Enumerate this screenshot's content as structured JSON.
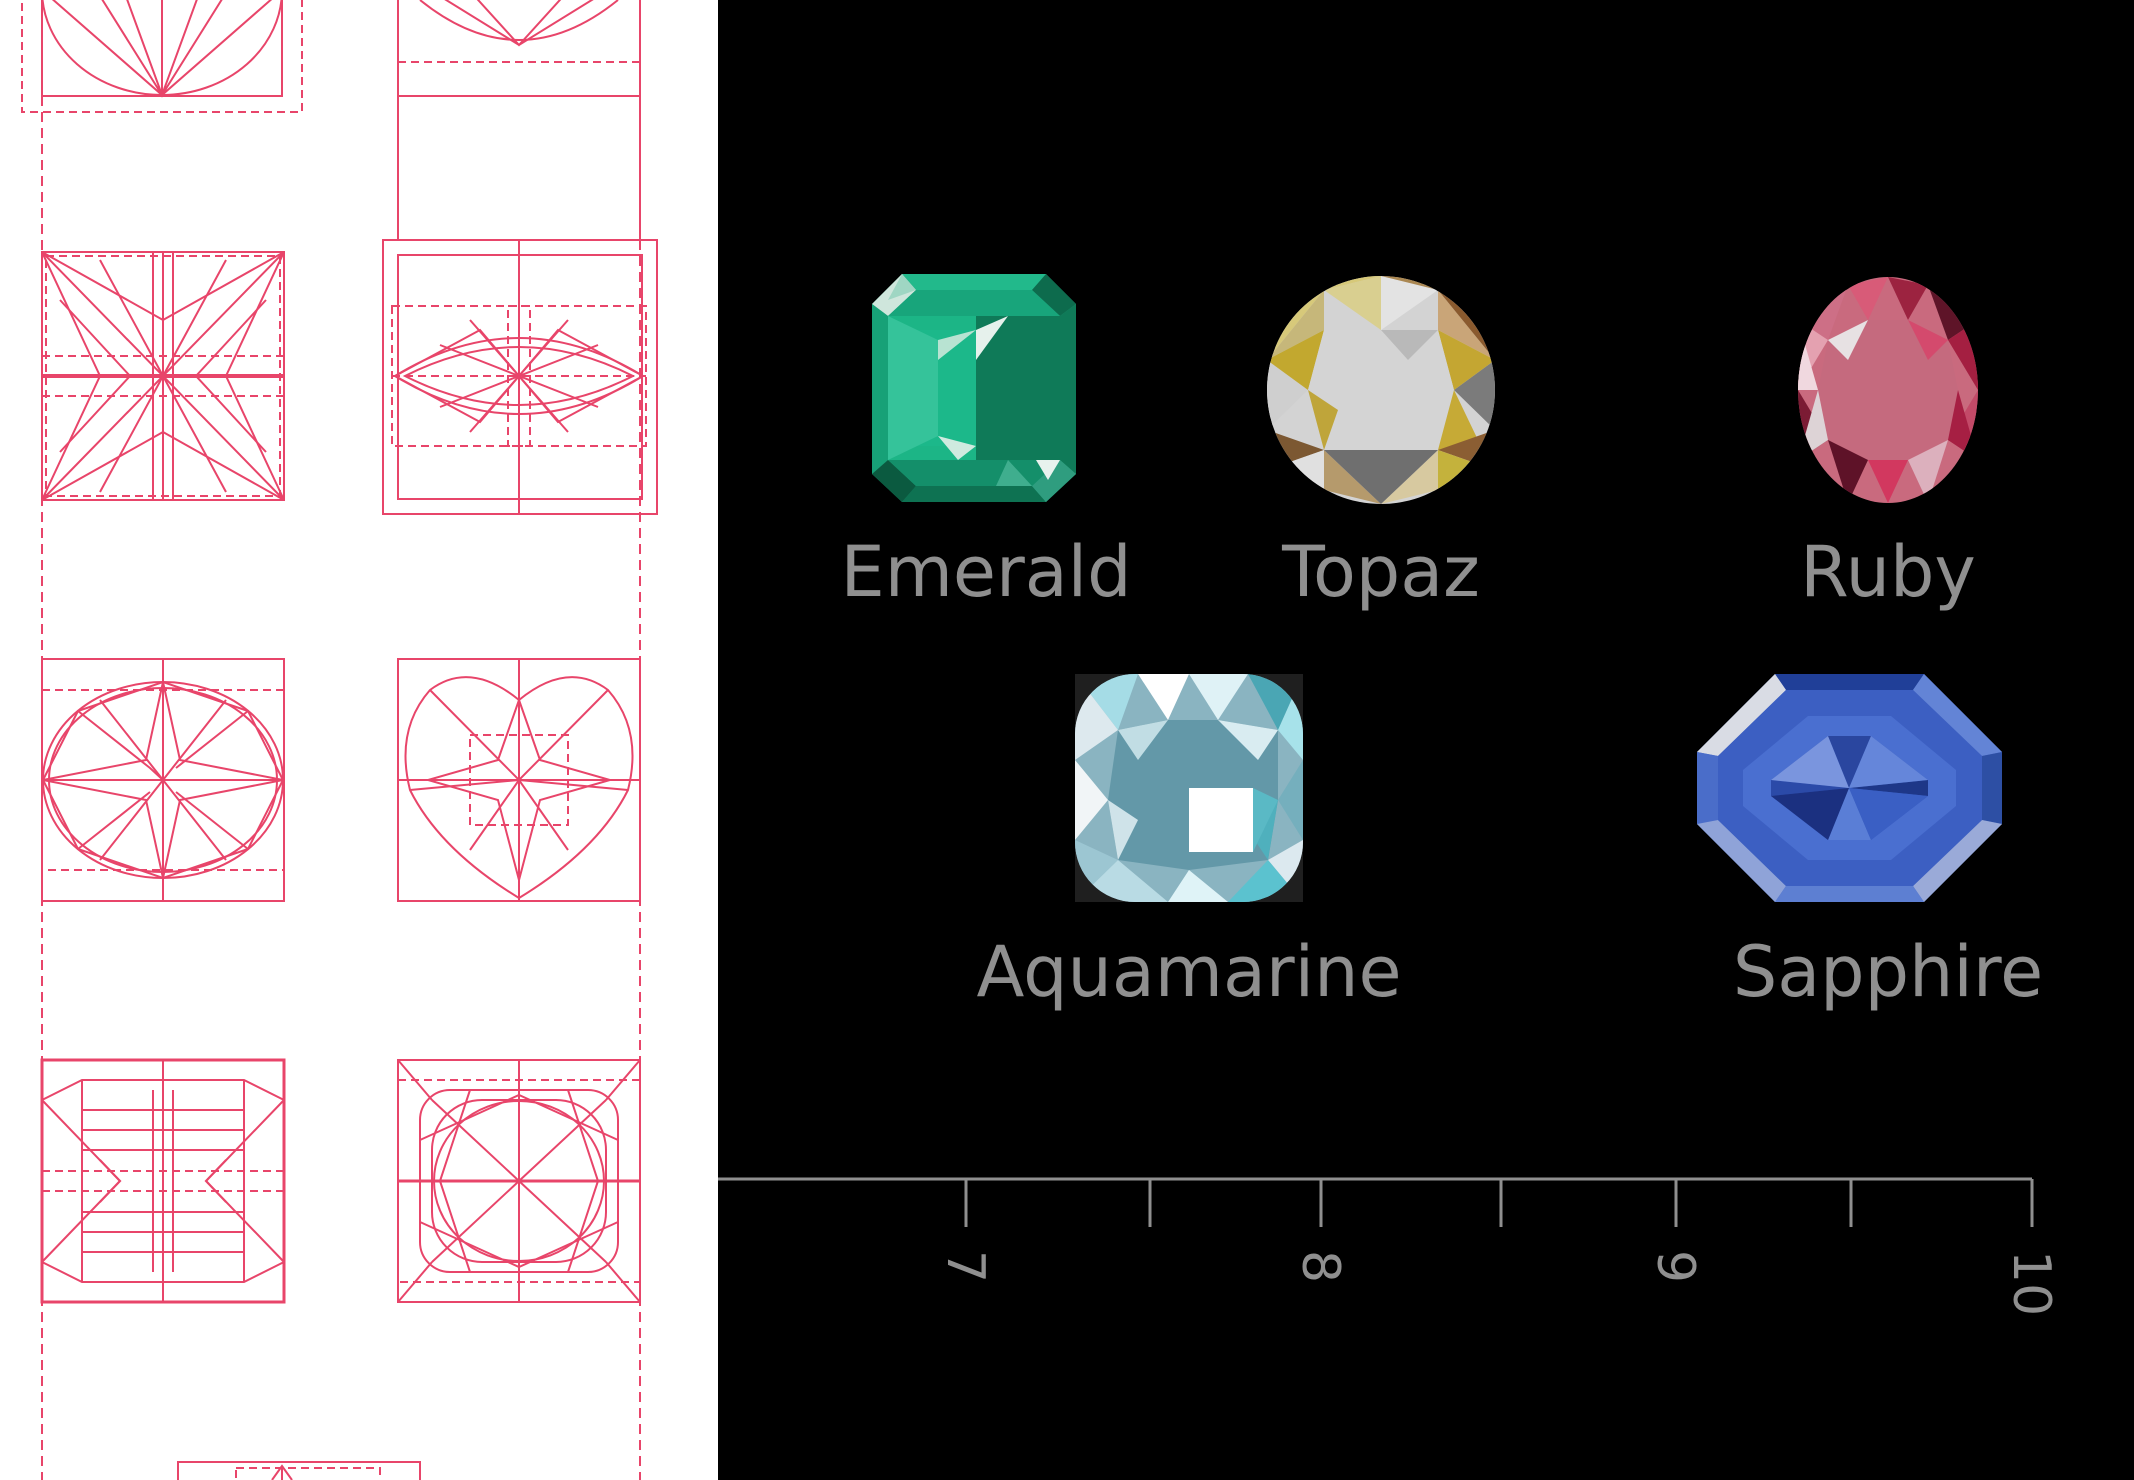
{
  "gems": [
    {
      "id": "emerald",
      "name": "Emerald",
      "shape": "emerald-cut",
      "color": "#1bb585"
    },
    {
      "id": "topaz",
      "name": "Topaz",
      "shape": "round-brilliant",
      "color": "#d4d4d4"
    },
    {
      "id": "ruby",
      "name": "Ruby",
      "shape": "oval",
      "color": "#cf4a6e"
    },
    {
      "id": "aquamarine",
      "name": "Aquamarine",
      "shape": "cushion",
      "color": "#7fb6c4"
    },
    {
      "id": "sapphire",
      "name": "Sapphire",
      "shape": "asscher",
      "color": "#3f62c4"
    }
  ],
  "axis": {
    "major_ticks": [
      {
        "value": 7,
        "label": "7"
      },
      {
        "value": 8,
        "label": "8"
      },
      {
        "value": 9,
        "label": "9"
      },
      {
        "value": 10,
        "label": "10"
      }
    ],
    "minor_ticks": [
      7.5,
      8.5,
      9.5
    ],
    "color": "#8f8f8f"
  },
  "blueprint": {
    "line_color": "#e8456a",
    "shapes": [
      "oval",
      "pear",
      "princess",
      "marquise",
      "oval-brilliant",
      "heart",
      "radiant",
      "cushion",
      "triangle"
    ]
  }
}
